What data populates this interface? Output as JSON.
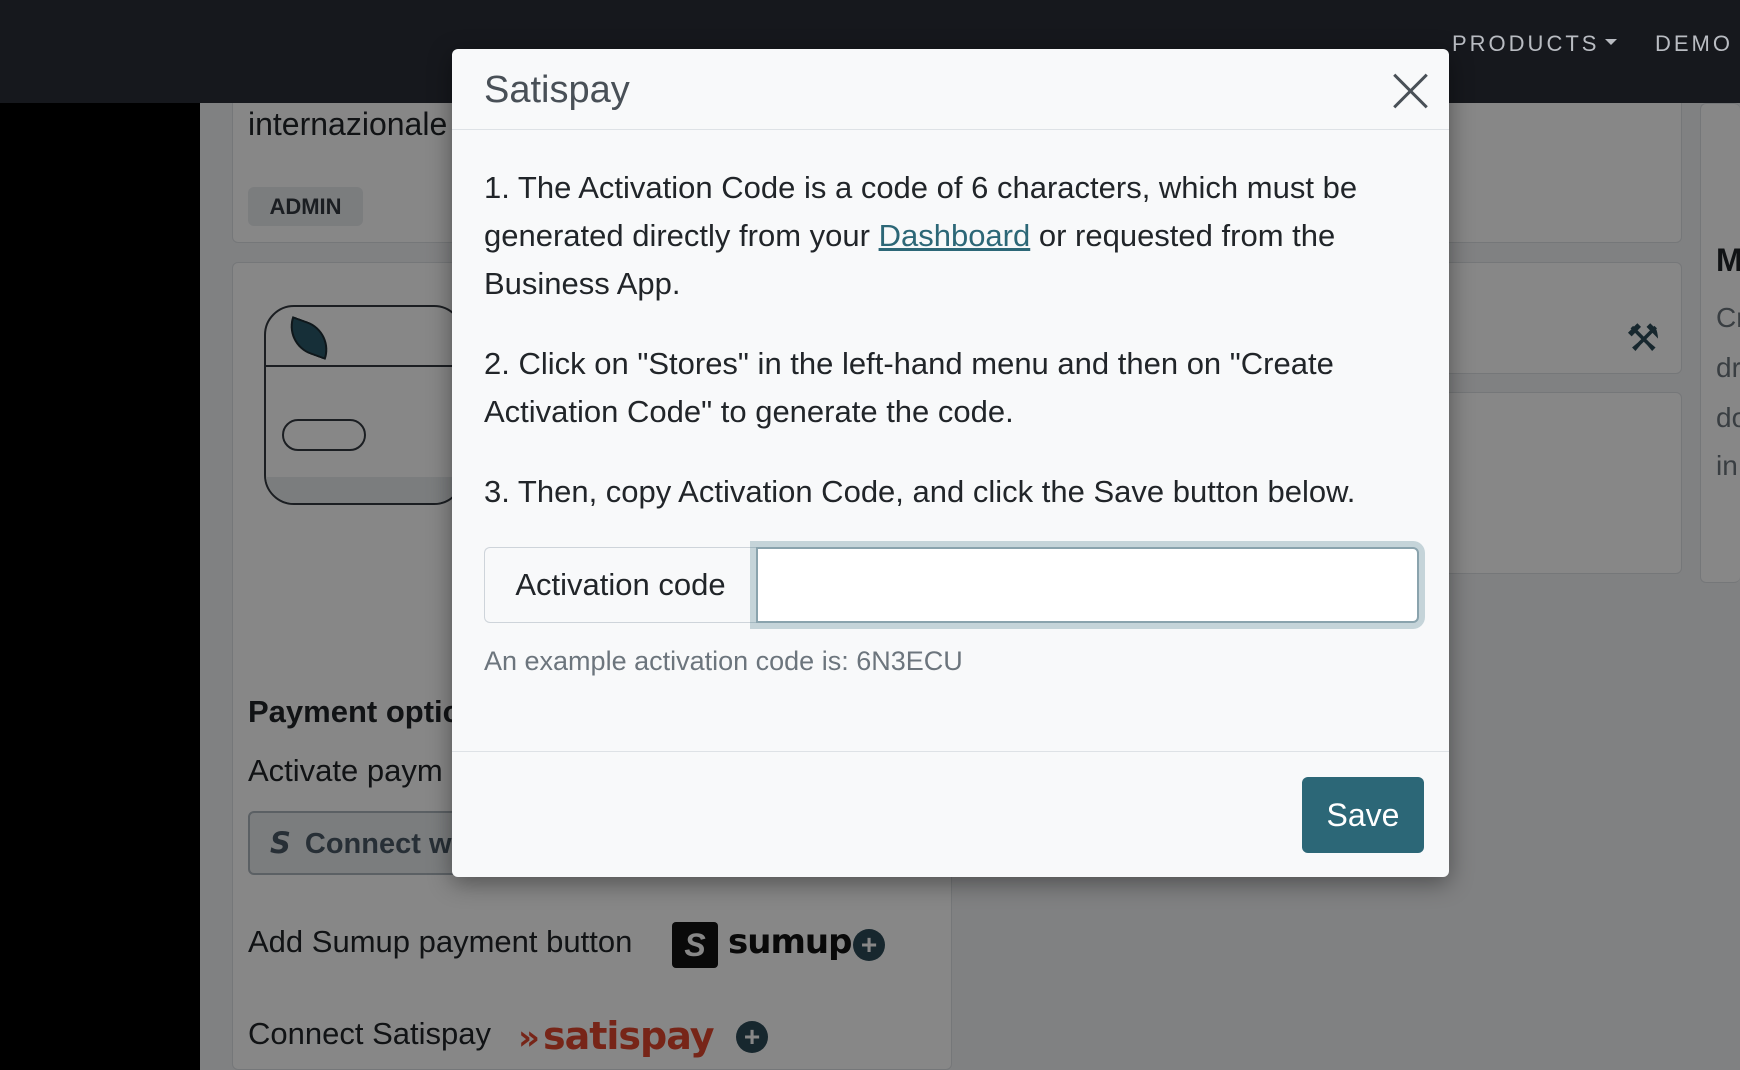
{
  "nav": {
    "products_label": "PRODUCTS",
    "demo_label": "DEMO"
  },
  "background": {
    "title_fragment": "internazionale",
    "admin_badge": "ADMIN",
    "payment_options_heading": "Payment optic",
    "activate_text": "Activate paym",
    "connect_button_label": "Connect w",
    "sumup_row_label": "Add Sumup payment button",
    "sumup_logo_text": "sumup",
    "satispay_row_label": "Connect Satispay",
    "satispay_logo_text": "satispay",
    "right_heading": "M",
    "right_lines": [
      "Cr",
      "dr",
      "do",
      "in"
    ]
  },
  "modal": {
    "title": "Satispay",
    "step1_before": "1. The Activation Code is a code of 6 characters, which must be generated directly from your ",
    "step1_link": "Dashboard",
    "step1_after": " or requested from the Business App.",
    "step2": "2. Click on \"Stores\" in the left-hand menu and then on \"Create Activation Code\" to generate the code.",
    "step3": "3. Then, copy Activation Code, and click the Save button below.",
    "input_label": "Activation code",
    "input_value": "",
    "help_text": "An example activation code is: 6N3ECU",
    "save_label": "Save"
  },
  "colors": {
    "primary": "#2c6777",
    "satispay_red": "#e0472f",
    "nav_bg": "#16181d"
  }
}
